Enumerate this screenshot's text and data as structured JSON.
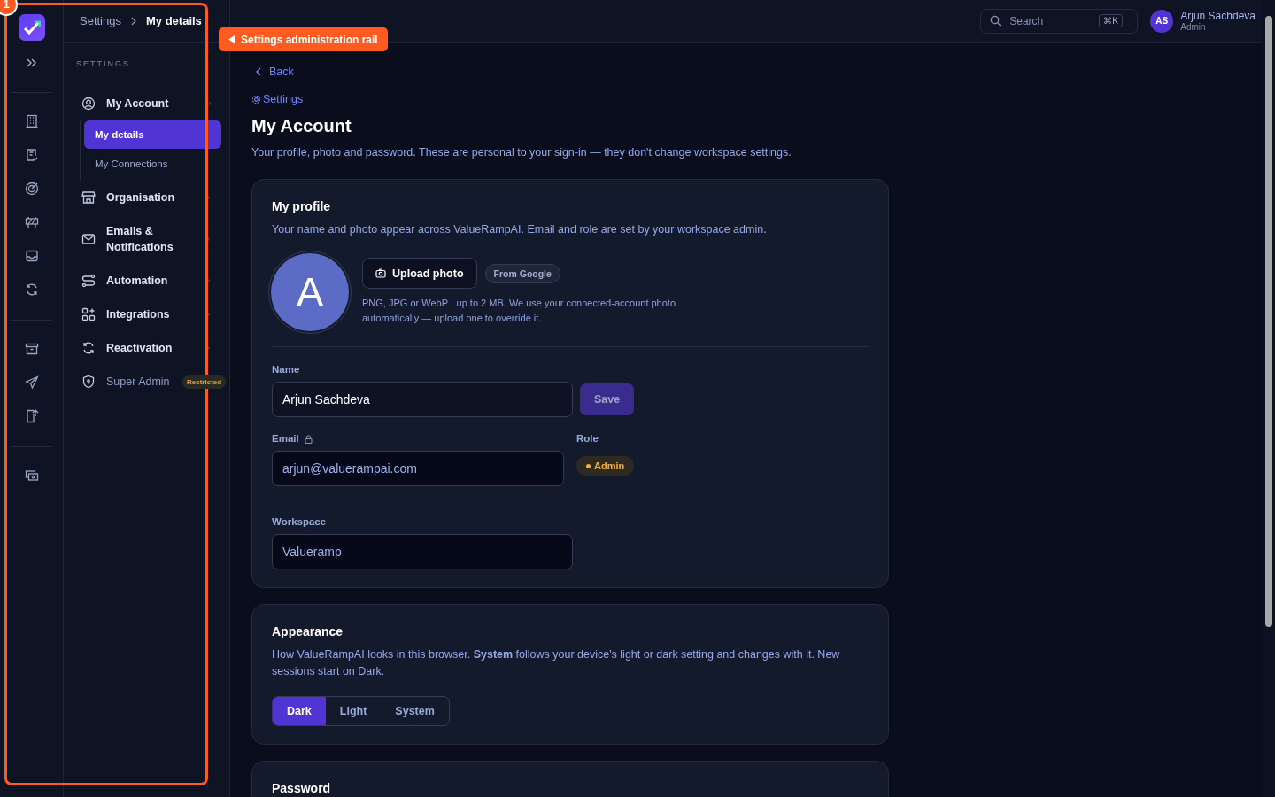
{
  "annotation": {
    "number": "1",
    "label": "Settings administration rail"
  },
  "breadcrumb": [
    "Settings",
    "My details"
  ],
  "nav": {
    "heading": "SETTINGS",
    "items": [
      {
        "label": "My Account",
        "expanded": true,
        "children": [
          {
            "label": "My details",
            "selected": true
          },
          {
            "label": "My Connections",
            "selected": false
          }
        ]
      },
      {
        "label": "Organisation",
        "expanded": false
      },
      {
        "label": "Emails & Notifications",
        "expanded": false
      },
      {
        "label": "Automation",
        "expanded": false
      },
      {
        "label": "Integrations",
        "expanded": false
      },
      {
        "label": "Reactivation",
        "expanded": false
      },
      {
        "label": "Super Admin",
        "disabled": true,
        "badge": "Restricted"
      }
    ]
  },
  "topbar": {
    "search": {
      "placeholder": "Search",
      "shortcut": "⌘K"
    },
    "user": {
      "initials": "AS",
      "name": "Arjun Sachdeva",
      "role": "Admin"
    }
  },
  "header": {
    "back": "Back",
    "crumb": "Settings",
    "title": "My Account",
    "subtitle": "Your profile, photo and password. These are personal to your sign-in — they don't change workspace settings."
  },
  "profile": {
    "title": "My profile",
    "description": "Your name and photo appear across ValueRampAI. Email and role are set by your workspace admin.",
    "avatar": "A",
    "upload": "Upload photo",
    "source": "From Google",
    "hint": "PNG, JPG or WebP · up to 2 MB. We use your connected-account photo automatically — upload one to override it.",
    "name": {
      "label": "Name",
      "value": "Arjun Sachdeva",
      "save": "Save",
      "save_disabled": true
    },
    "email": {
      "label": "Email",
      "value": "arjun@valuerampai.com",
      "locked": true
    },
    "role": {
      "label": "Role",
      "value": "Admin",
      "color": "#f0b232"
    },
    "workspace": {
      "label": "Workspace",
      "value": "Valueramp"
    }
  },
  "appearance": {
    "title": "Appearance",
    "description": "How ValueRampAI looks in this browser. **System** follows your device's light or dark setting and changes with it. New sessions start on Dark.",
    "options": [
      {
        "label": "Dark",
        "selected": true
      },
      {
        "label": "Light",
        "selected": false
      },
      {
        "label": "System",
        "selected": false
      }
    ]
  },
  "password": {
    "title": "Password"
  }
}
